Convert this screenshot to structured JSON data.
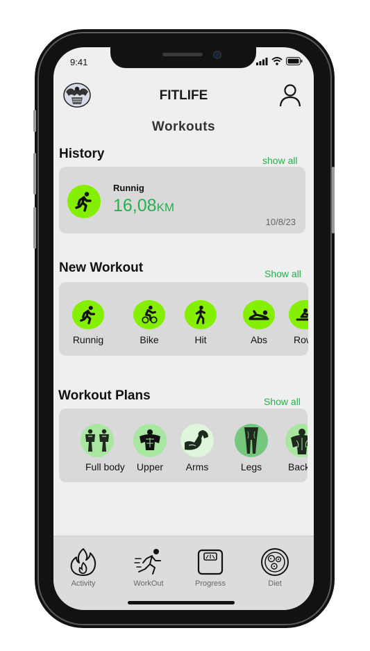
{
  "status_bar": {
    "time": "9:41"
  },
  "header": {
    "app_title": "FITLIFE",
    "page_title": "Workouts"
  },
  "history": {
    "title": "History",
    "show_all": "show all",
    "entry": {
      "activity": "Runnig",
      "distance": "16,08",
      "unit": "KM",
      "date": "10/8/23"
    }
  },
  "new_workout": {
    "title": "New Workout",
    "show_all": "Show all",
    "items": [
      {
        "label": "Runnig",
        "icon": "running-icon"
      },
      {
        "label": "Bike",
        "icon": "bike-icon"
      },
      {
        "label": "Hit",
        "icon": "hit-icon"
      },
      {
        "label": "Abs",
        "icon": "abs-icon"
      },
      {
        "label": "Rowing",
        "icon": "rowing-icon"
      }
    ]
  },
  "workout_plans": {
    "title": "Workout Plans",
    "show_all": "Show all",
    "items": [
      {
        "label": "Full body",
        "icon": "full-body-icon"
      },
      {
        "label": "Upper",
        "icon": "upper-body-icon"
      },
      {
        "label": "Arms",
        "icon": "arms-icon"
      },
      {
        "label": "Legs",
        "icon": "legs-icon"
      },
      {
        "label": "Back",
        "icon": "back-icon"
      }
    ]
  },
  "nav": {
    "items": [
      {
        "label": "Activity",
        "icon": "flame-icon"
      },
      {
        "label": "WorkOut",
        "icon": "workout-icon"
      },
      {
        "label": "Progress",
        "icon": "scale-icon"
      },
      {
        "label": "Diet",
        "icon": "food-plate-icon"
      }
    ]
  },
  "colors": {
    "accent_green": "#84ef00",
    "text_green": "#22b14c",
    "plan_green": "#a9e6a2",
    "card_bg": "#d9d9d9"
  }
}
